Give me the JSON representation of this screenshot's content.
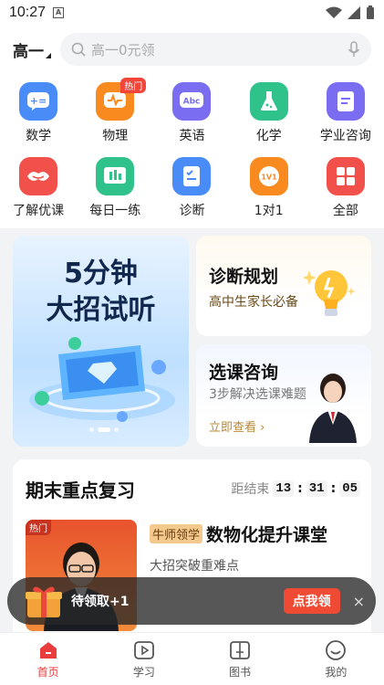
{
  "status": {
    "time": "10:27",
    "notif_letter": "A"
  },
  "header": {
    "grade": "高一",
    "search_placeholder": "高一0元领"
  },
  "categories": [
    {
      "label": "数学",
      "icon": "math-icon",
      "color": "#4a8cf7"
    },
    {
      "label": "物理",
      "icon": "physics-icon",
      "color": "#f88a1f",
      "badge": "热门"
    },
    {
      "label": "英语",
      "icon": "english-icon",
      "color": "#7a6df2",
      "glyph": "Abc"
    },
    {
      "label": "化学",
      "icon": "chemistry-icon",
      "color": "#2fc28a"
    },
    {
      "label": "学业咨询",
      "icon": "consult-icon",
      "color": "#7a6df2"
    },
    {
      "label": "了解优课",
      "icon": "youke-icon",
      "color": "#f2514b"
    },
    {
      "label": "每日一练",
      "icon": "daily-practice-icon",
      "color": "#2fc28a"
    },
    {
      "label": "诊断",
      "icon": "diagnosis-icon",
      "color": "#4a8cf7"
    },
    {
      "label": "1对1",
      "icon": "one-on-one-icon",
      "color": "#f88a1f",
      "glyph": "1V1"
    },
    {
      "label": "全部",
      "icon": "all-icon",
      "color": "#f2514b"
    }
  ],
  "banner": {
    "line1": "5分钟",
    "line2": "大招试听"
  },
  "cards": {
    "diag": {
      "title": "诊断规划",
      "sub": "高中生家长必备"
    },
    "course": {
      "title": "选课咨询",
      "sub": "3步解决选课难题",
      "link": "立即查看 ›"
    }
  },
  "review": {
    "title": "期末重点复习",
    "countdown_label": "距结束",
    "hh": "13",
    "mm": "31",
    "ss": "05",
    "course": {
      "hot": "热门",
      "tag": "牛师领学",
      "name": "数物化提升课堂",
      "sub": "大招突破重难点"
    }
  },
  "float_bar": {
    "text": "待领取+1",
    "button": "点我领",
    "close": "×"
  },
  "tabs": [
    {
      "label": "首页",
      "active": true
    },
    {
      "label": "学习",
      "active": false
    },
    {
      "label": "图书",
      "active": false
    },
    {
      "label": "我的",
      "active": false
    }
  ],
  "colors": {
    "accent": "#e93c3c"
  }
}
